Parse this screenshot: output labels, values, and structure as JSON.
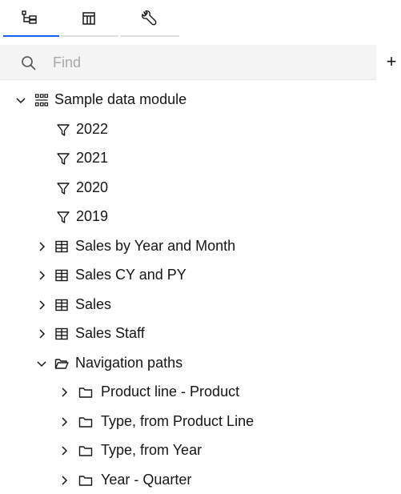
{
  "tabs": [
    {
      "name": "Data tree",
      "icon": "data-tree-icon"
    },
    {
      "name": "Layout",
      "icon": "layout-icon"
    },
    {
      "name": "Tools",
      "icon": "wrench-icon"
    }
  ],
  "search": {
    "placeholder": "Find",
    "value": ""
  },
  "add_label": "+",
  "tree": {
    "root": {
      "label": "Sample data module",
      "icon": "data-module-icon",
      "expanded": true
    },
    "filters": [
      "2022",
      "2021",
      "2020",
      "2019"
    ],
    "tables": [
      "Sales by Year and Month",
      "Sales CY and PY",
      "Sales",
      "Sales Staff"
    ],
    "nav_folder": {
      "label": "Navigation paths",
      "icon": "folder-open-icon",
      "expanded": true
    },
    "nav_paths": [
      "Product line - Product",
      "Type, from Product Line",
      "Type, from Year",
      "Year - Quarter"
    ]
  },
  "colors": {
    "accent": "#0f62fe",
    "search_bg": "#f4f4f4",
    "placeholder": "#a8a8a8"
  }
}
